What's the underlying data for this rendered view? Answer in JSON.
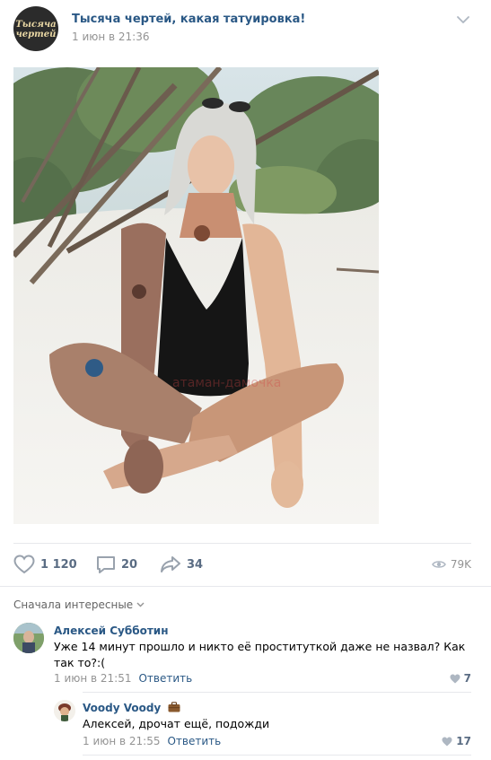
{
  "post": {
    "group_name": "Тысяча чертей, какая татуировка!",
    "date": "1 июн в 21:36",
    "avatar_text_line1": "Тысяча",
    "avatar_text_line2": "чертей",
    "watermark": "атаман-дамочка"
  },
  "actions": {
    "likes": "1 120",
    "comments": "20",
    "shares": "34",
    "views": "79K"
  },
  "comments": {
    "sort_label": "Сначала интересные",
    "items": [
      {
        "author": "Алексей Субботин",
        "text": "Уже 14 минут прошло и никто её проституткой даже не назвал? Как так то?:(",
        "date": "1 июн в 21:51",
        "reply_label": "Ответить",
        "likes": "7"
      },
      {
        "author": "Voody Voody",
        "text": "Алексей, дрочат ещё, подожди",
        "date": "1 июн в 21:55",
        "reply_label": "Ответить",
        "likes": "17"
      }
    ]
  },
  "colors": {
    "link": "#2a5885",
    "muted": "#939393",
    "icon": "#99a2ad",
    "divider": "#e7e8ec"
  },
  "icons": {
    "menu": "chevron-down-icon",
    "like": "heart-icon",
    "comment": "speech-bubble-icon",
    "share": "share-arrow-icon",
    "views": "eye-icon"
  }
}
